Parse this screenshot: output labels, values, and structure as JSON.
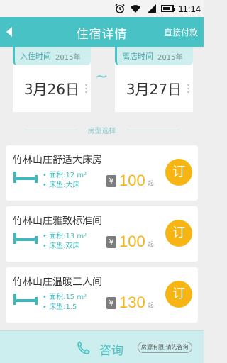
{
  "status_bar": {
    "time": "11:14"
  },
  "header": {
    "title": "住宿详情",
    "action": "直接付款"
  },
  "checkin": {
    "label": "入住时间",
    "year": "2015年",
    "date": "3月26日"
  },
  "checkout": {
    "label": "离店时间",
    "year": "2015年",
    "date": "3月27日"
  },
  "separator": "~",
  "section": {
    "label": "房型选择"
  },
  "rooms": [
    {
      "name": "竹林山庄舒适大床房",
      "area": "面积:12 m²",
      "bed": "床型:大床",
      "currency": "¥",
      "price": "100",
      "unit": "起",
      "book": "订"
    },
    {
      "name": "竹林山庄雅致标准间",
      "area": "面积:13 m²",
      "bed": "床型:双床",
      "currency": "¥",
      "price": "100",
      "unit": "起",
      "book": "订"
    },
    {
      "name": "竹林山庄温暖三人间",
      "area": "面积:15 m²",
      "bed": "床型:1.5",
      "currency": "¥",
      "price": "130",
      "unit": "起",
      "book": "订"
    }
  ],
  "bottom": {
    "consult": "咨询",
    "notice": "房源有限,请先咨询"
  },
  "colors": {
    "accent": "#49c2c6",
    "price": "#f4b31a",
    "book_button": "#f7b513"
  }
}
